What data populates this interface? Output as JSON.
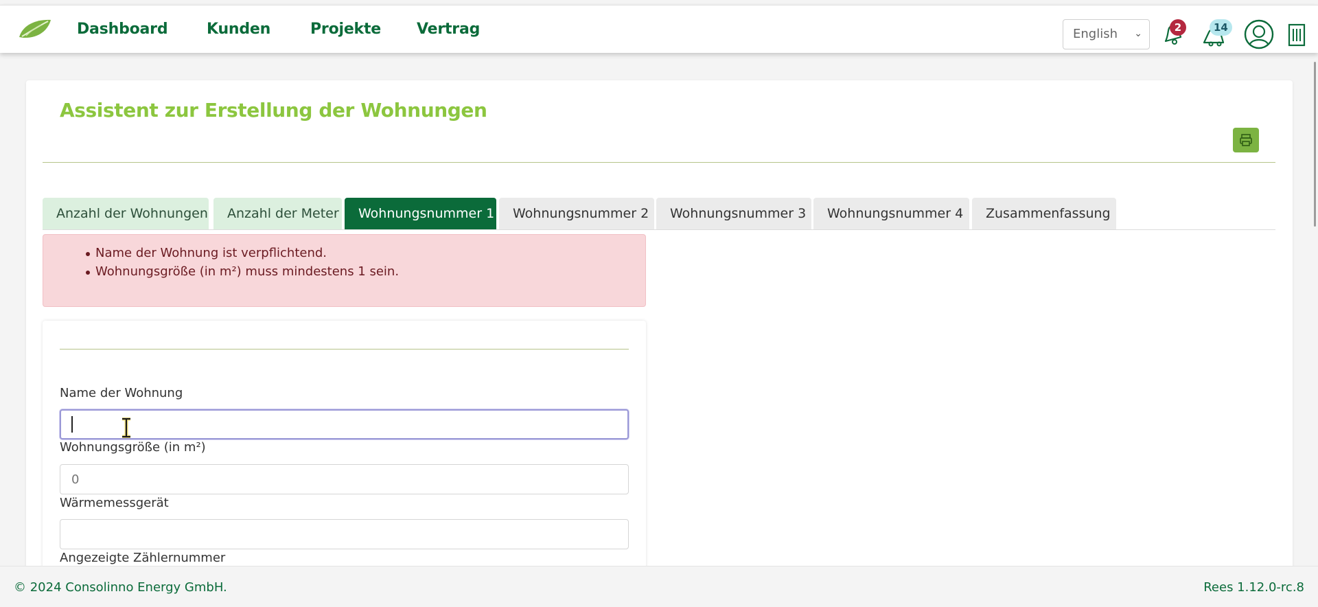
{
  "nav": {
    "links": [
      "Dashboard",
      "Kunden",
      "Projekte",
      "Vertrag"
    ],
    "language": "English",
    "notifications_count": "2",
    "messages_count": "14"
  },
  "page": {
    "title": "Assistent zur Erstellung der Wohnungen"
  },
  "tabs": [
    {
      "label": "Anzahl der Wohnungen",
      "state": "done"
    },
    {
      "label": "Anzahl der Meter",
      "state": "done"
    },
    {
      "label": "Wohnungsnummer 1",
      "state": "active"
    },
    {
      "label": "Wohnungsnummer 2",
      "state": "pending"
    },
    {
      "label": "Wohnungsnummer 3",
      "state": "pending"
    },
    {
      "label": "Wohnungsnummer 4",
      "state": "pending"
    },
    {
      "label": "Zusammenfassung",
      "state": "pending"
    }
  ],
  "alert": {
    "errors": [
      "Name der Wohnung ist verpflichtend.",
      "Wohnungsgröße (in m²) muss mindestens 1 sein."
    ]
  },
  "form": {
    "name_label": "Name der Wohnung",
    "name_value": "",
    "size_label": "Wohnungsgröße (in m²)",
    "size_placeholder": "0",
    "heat_label": "Wärmemessgerät",
    "heat_value": "",
    "meter_label": "Angezeigte Zählernummer"
  },
  "footer": {
    "copyright": "© 2024 Consolinno Energy GmbH.",
    "version": "Rees 1.12.0-rc.8"
  },
  "colors": {
    "brand_green": "#0b6b3a",
    "accent_green": "#8cc63f",
    "alert_bg": "#f8d7da",
    "badge_red": "#b4283f",
    "badge_cyan": "#b6e7ee"
  },
  "icons": [
    "leaf-logo-icon",
    "bell-icon",
    "chat-bell-icon",
    "user-avatar-icon",
    "building-icon",
    "printer-icon",
    "chevron-down-icon",
    "text-cursor-icon"
  ]
}
